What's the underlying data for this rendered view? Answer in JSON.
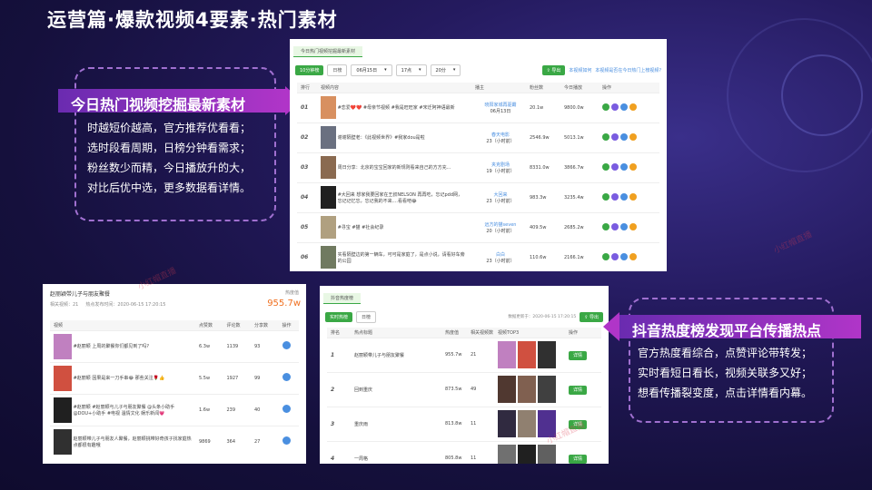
{
  "title": "运营篇·爆款视频4要素·热门素材",
  "top_section": {
    "banner": "今日热门视频挖掘最新素材",
    "desc": [
      "时越短价越高，官方推荐优看看；",
      "选时段看周期，日榜分钟看需求；",
      "粉丝数少而精，今日播放升的大，",
      "对比后优中选，更多数据看详情。"
    ]
  },
  "bottom_section": {
    "banner": "抖音热度榜发现平台传播热点",
    "desc": [
      "官方热度看综合，点赞评论带转发；",
      "实时看短日看长，视频关联多又好；",
      "想看传播裂变度，点击详情看内幕。"
    ]
  },
  "panel1": {
    "tab": "今日热门视频挖掘最新素材",
    "btn_10min": "10分钟榜",
    "btn_day": "日榜",
    "sel_date": "06月15日",
    "sel_time": "17点",
    "sel_min": "20分",
    "export": "导出",
    "link1": "本视频如何",
    "link2": "本视频是否在今日热门上榜视频?",
    "headers": [
      "排行",
      "视频内容",
      "播主",
      "粉丝数",
      "今日播放",
      "操作"
    ],
    "rows": [
      {
        "rank": "01",
        "content": "#恋爱❤️❤️ #母亲节视频 #我是旺旺家 #宋迁阿神语最新",
        "author": "晓阳家城再驱霸",
        "sub": "06月13日",
        "fans": "20.1w",
        "play": "9800.0w",
        "c": "#d89060"
      },
      {
        "rank": "02",
        "content": "谢谢隔壁老：《此视频世界》#我家dou是啦",
        "author": "春天电影",
        "sub": "23（小时前）",
        "fans": "2546.9w",
        "play": "5013.1w",
        "c": "#6a7080"
      },
      {
        "rank": "03",
        "content": "周日分享：北京的宝宝回家的新规则看来自己的方方充...",
        "author": "夹克剧场",
        "sub": "19（小时前）",
        "fans": "8331.0w",
        "play": "3866.7w",
        "c": "#8a6a50"
      },
      {
        "rank": "04",
        "content": "#大回来 想家我要回家在王叔NELSON 再再吃，忘记pdd网，忘记记忆忘，忘记我的不来....看看吧😂",
        "author": "大回来",
        "sub": "23（小时前）",
        "fans": "983.3w",
        "play": "3235.4w",
        "c": "#202020"
      },
      {
        "rank": "05",
        "content": "#寻宝 #猫 #社会纪录",
        "author": "远方的猫seven",
        "sub": "20（小时前）",
        "fans": "409.5w",
        "play": "2685.2w",
        "c": "#b0a080"
      },
      {
        "rank": "06",
        "content": "实看隔壁边的第一辆车，可可是家庭了，是点小说，请看好车旁的公园",
        "author": "白白",
        "sub": "23（小时前）",
        "fans": "110.6w",
        "play": "2166.1w",
        "c": "#707a60"
      }
    ]
  },
  "panel2": {
    "title": "赵丽颖带儿子与朋友聚餐",
    "metric_label": "热度值",
    "metric": "955.7w",
    "meta1": "相关视频：21",
    "meta2": "热点发布时间：2020-06-15 17:20:15",
    "headers": [
      "视频",
      "点赞数",
      "评论数",
      "分享数",
      "操作"
    ],
    "rows": [
      {
        "content": "#赵丽颖 上周的聚餐你们都见到了吗?",
        "likes": "6.3w",
        "comments": "1139",
        "shares": "93",
        "c": "#c080c0"
      },
      {
        "content": "#赵丽颖 因果是来一刀手串😂 那些关注🌹👍",
        "likes": "5.5w",
        "comments": "1927",
        "shares": "99",
        "c": "#d05040"
      },
      {
        "content": "#赵丽颖 #赵丽颖与儿子与朋友聚餐 @头条小助手 @DOU+小助手 #电视 温情文化 娱乐新闻💗",
        "likes": "1.6w",
        "comments": "239",
        "shares": "40",
        "c": "#202020"
      },
      {
        "content": "赵丽颖带儿子与朋友人聚餐，赵丽颖挑带好奇孩子找家庭热点都很有趣哦",
        "likes": "9869",
        "comments": "364",
        "shares": "27",
        "c": "#303030"
      }
    ]
  },
  "panel3": {
    "tab": "抖音热度榜",
    "btn1": "实时热榜",
    "btn2": "日榜",
    "updated": "数据更新于：2020-06-15 17:20:15",
    "export": "导出",
    "headers": [
      "排名",
      "热点标题",
      "热度值",
      "相关视频数",
      "视频TOP3",
      "操作"
    ],
    "rows": [
      {
        "rank": "1",
        "title": "赵丽颖带儿子与朋友聚餐",
        "heat": "955.7w",
        "count": "21",
        "op": "详情",
        "colors": [
          "#c080c0",
          "#d05040",
          "#303030"
        ]
      },
      {
        "rank": "2",
        "title": "回到重庆",
        "heat": "873.5w",
        "count": "49",
        "op": "详情",
        "colors": [
          "#503830",
          "#806050",
          "#404040"
        ]
      },
      {
        "rank": "3",
        "title": "重庆雨",
        "heat": "813.8w",
        "count": "11",
        "op": "详情",
        "colors": [
          "#302a40",
          "#908070",
          "#503090"
        ]
      },
      {
        "rank": "4",
        "title": "一周格",
        "heat": "805.8w",
        "count": "11",
        "op": "详情",
        "colors": [
          "#707070",
          "#202020",
          "#606060"
        ]
      }
    ]
  },
  "watermark": "小红帽直播"
}
